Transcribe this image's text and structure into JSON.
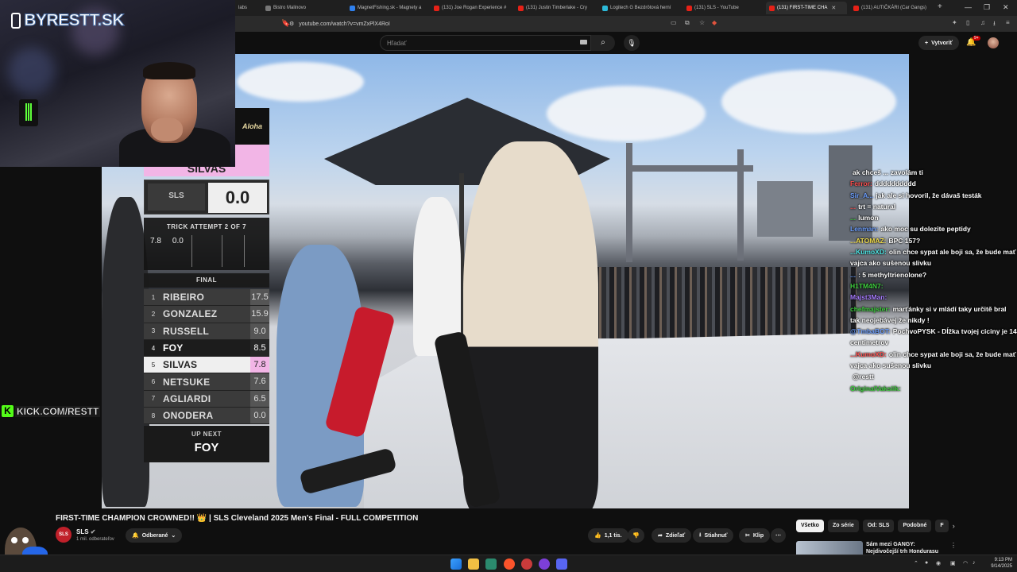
{
  "browser": {
    "tabs": [
      {
        "label": "labs",
        "icon": "tab-icon"
      },
      {
        "label": "Bistro Malinovo",
        "icon": "globe-icon"
      },
      {
        "label": "MagnetFishing.sk - Magnety a",
        "icon": "site-icon"
      },
      {
        "label": "(131) Joe Rogan Experience #",
        "icon": "youtube-icon"
      },
      {
        "label": "(131) Justin Timberlake - Cry",
        "icon": "youtube-icon"
      },
      {
        "label": "Logitech G Bezdrôtová herní",
        "icon": "site-icon"
      },
      {
        "label": "(131) SLS - YouTube",
        "icon": "youtube-icon"
      },
      {
        "label": "(131) FIRST-TIME CHA",
        "icon": "youtube-icon",
        "active": true
      },
      {
        "label": "(131) AUTIČKÁRI (Car Gangs)",
        "icon": "youtube-icon"
      }
    ],
    "url": "youtube.com/watch?v=vmZxPlX4RoI"
  },
  "youtube": {
    "search_placeholder": "Hľadať",
    "create_label": "Vytvoriť",
    "notif_badge": "9+"
  },
  "stream": {
    "brand": "BYRESTT.SK",
    "kick": "KICK.COM/RESTT"
  },
  "scoreboard": {
    "sponsor": "Aloha",
    "current_skater": "SILVAS",
    "current_score": "0.0",
    "logo": "SLS",
    "attempt_title": "TRICK ATTEMPT 2 OF 7",
    "attempt_scores": [
      "7.8",
      "0.0"
    ],
    "final_label": "FINAL",
    "standings": [
      {
        "rank": "1",
        "name": "RIBEIRO",
        "score": "17.5",
        "style": "normal"
      },
      {
        "rank": "2",
        "name": "GONZALEZ",
        "score": "15.9",
        "style": "normal"
      },
      {
        "rank": "3",
        "name": "RUSSELL",
        "score": "9.0",
        "style": "normal"
      },
      {
        "rank": "4",
        "name": "FOY",
        "score": "8.5",
        "style": "dark"
      },
      {
        "rank": "5",
        "name": "SILVAS",
        "score": "7.8",
        "style": "highlight"
      },
      {
        "rank": "6",
        "name": "NETSUKE",
        "score": "7.6",
        "style": "normal"
      },
      {
        "rank": "7",
        "name": "AGLIARDI",
        "score": "6.5",
        "style": "normal"
      },
      {
        "rank": "8",
        "name": "ONODERA",
        "score": "0.0",
        "style": "normal"
      }
    ],
    "upnext_label": "UP NEXT",
    "upnext_name": "FOY"
  },
  "chat": [
    {
      "user": "",
      "text": "ak chceš ... zavolám ti",
      "color": "u-pink"
    },
    {
      "user": "Ferror:",
      "text": "dddddddddd",
      "color": "u-red"
    },
    {
      "user": "Sir_A...",
      "text": "jak ale si hovoril, že dávaš testák",
      "color": "u-blue"
    },
    {
      "user": "...",
      "text": "trt = natural",
      "color": "u-red"
    },
    {
      "user": "...",
      "text": "lumon",
      "color": "u-green"
    },
    {
      "user": "Lenman:",
      "text": "ako moc su dolezite peptidy",
      "color": "u-blue"
    },
    {
      "user": "...ATOMAZ:",
      "text": "BPC 157?",
      "color": "u-yellow"
    },
    {
      "user": "...KumoXD:",
      "text": "olin chce sypat ale boji sa, že bude mať vajca ako sušenou slivku",
      "color": "u-cyan"
    },
    {
      "user": "...",
      "text": ": 5 methyltrienolone?",
      "color": "u-blue"
    },
    {
      "user": "H1TM4N7:",
      "text": "",
      "color": "u-green"
    },
    {
      "user": "Majst3Man:",
      "text": "",
      "color": "u-purple"
    },
    {
      "user": "chefmajster:",
      "text": "marťánky si v mládí taky určitě bral tak neojebávej že nikdy !",
      "color": "u-green"
    },
    {
      "user": "@TmbaBOT:",
      "text": "PochvoPYSK - Dĺžka tvojej ciciny je 14 centimetrov",
      "color": "u-blue"
    },
    {
      "user": "...KumoXD:",
      "text": "olin chce sypat ale boji sa, že bude mať vajca ako sušenou slivku",
      "color": "u-red"
    },
    {
      "user": "",
      "text": "@restt",
      "color": "u-pink"
    },
    {
      "user": "OriginalVaksiik:",
      "text": "",
      "color": "u-green"
    }
  ],
  "video": {
    "title": "FIRST-TIME CHAMPION CROWNED!! 👑 | SLS Cleveland 2025 Men's Final - FULL COMPETITION",
    "channel": "SLS",
    "subs": "1 mil. odberateľov",
    "subscribed_label": "Odberané",
    "likes": "1,1 tis.",
    "share": "Zdieľať",
    "download": "Stiahnuť",
    "clip": "Klip"
  },
  "recs": {
    "chips": [
      "Všetko",
      "Zo série",
      "Od: SLS",
      "Podobné",
      "F"
    ],
    "first_title": "Sám mezi GANGY: Nejdivočejší trh Hondurasu"
  },
  "taskbar": {
    "time": "9:13 PM",
    "date": "9/14/2025"
  },
  "colors": {
    "pink_accent": "#f2b5e6",
    "kick_green": "#53fc18",
    "youtube_red": "#e62117"
  }
}
